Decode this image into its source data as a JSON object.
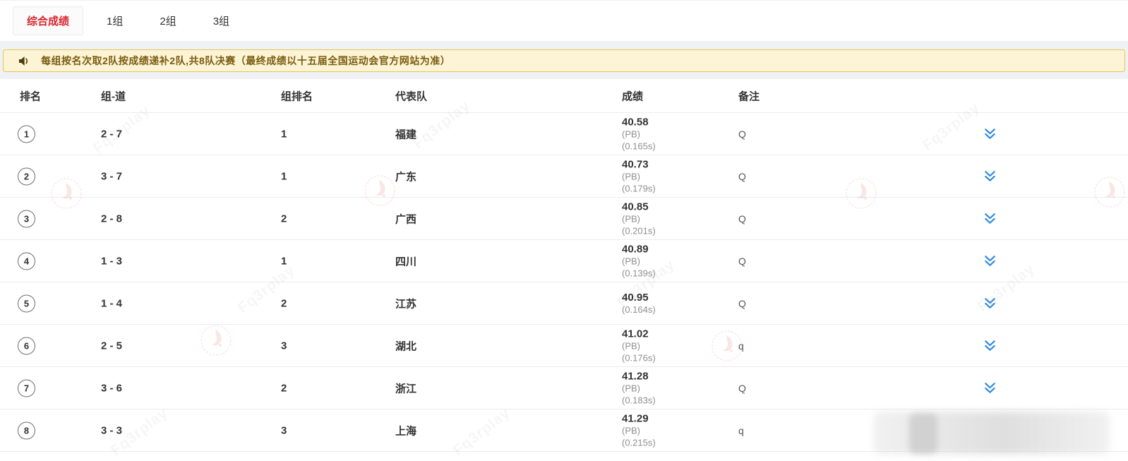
{
  "tabs": [
    {
      "label": "综合成绩",
      "active": true
    },
    {
      "label": "1组",
      "active": false
    },
    {
      "label": "2组",
      "active": false
    },
    {
      "label": "3组",
      "active": false
    }
  ],
  "notice": {
    "icon": "speaker-icon",
    "text": "每组按名次取2队按成绩递补2队,共8队决赛（最终成绩以十五届全国运动会官方网站为准）"
  },
  "table": {
    "headers": {
      "rank": "排名",
      "group_lane": "组-道",
      "group_rank": "组排名",
      "team": "代表队",
      "result": "成绩",
      "remark": "备注"
    },
    "rows": [
      {
        "rank": "1",
        "group_lane": "2 - 7",
        "group_rank": "1",
        "team": "福建",
        "result": "40.58",
        "result_notes": [
          "(PB)",
          "(0.165s)"
        ],
        "remark": "Q",
        "expander": true
      },
      {
        "rank": "2",
        "group_lane": "3 - 7",
        "group_rank": "1",
        "team": "广东",
        "result": "40.73",
        "result_notes": [
          "(PB)",
          "(0.179s)"
        ],
        "remark": "Q",
        "expander": true
      },
      {
        "rank": "3",
        "group_lane": "2 - 8",
        "group_rank": "2",
        "team": "广西",
        "result": "40.85",
        "result_notes": [
          "(PB)",
          "(0.201s)"
        ],
        "remark": "Q",
        "expander": true
      },
      {
        "rank": "4",
        "group_lane": "1 - 3",
        "group_rank": "1",
        "team": "四川",
        "result": "40.89",
        "result_notes": [
          "(PB)",
          "(0.139s)"
        ],
        "remark": "Q",
        "expander": true
      },
      {
        "rank": "5",
        "group_lane": "1 - 4",
        "group_rank": "2",
        "team": "江苏",
        "result": "40.95",
        "result_notes": [
          "(0.164s)"
        ],
        "remark": "Q",
        "expander": true
      },
      {
        "rank": "6",
        "group_lane": "2 - 5",
        "group_rank": "3",
        "team": "湖北",
        "result": "41.02",
        "result_notes": [
          "(PB)",
          "(0.176s)"
        ],
        "remark": "q",
        "expander": true
      },
      {
        "rank": "7",
        "group_lane": "3 - 6",
        "group_rank": "2",
        "team": "浙江",
        "result": "41.28",
        "result_notes": [
          "(PB)",
          "(0.183s)"
        ],
        "remark": "Q",
        "expander": true
      },
      {
        "rank": "8",
        "group_lane": "3 - 3",
        "group_rank": "3",
        "team": "上海",
        "result": "41.29",
        "result_notes": [
          "(PB)",
          "(0.215s)"
        ],
        "remark": "q",
        "expander": false
      }
    ]
  },
  "watermark": {
    "text": "Fq3rplay"
  },
  "colors": {
    "accent_red": "#d9232e",
    "notice_bg": "#fdf4d6",
    "notice_border": "#e8c455",
    "notice_text": "#7a5c10",
    "expand_icon": "#2f8be0",
    "row_border": "#ececec"
  }
}
